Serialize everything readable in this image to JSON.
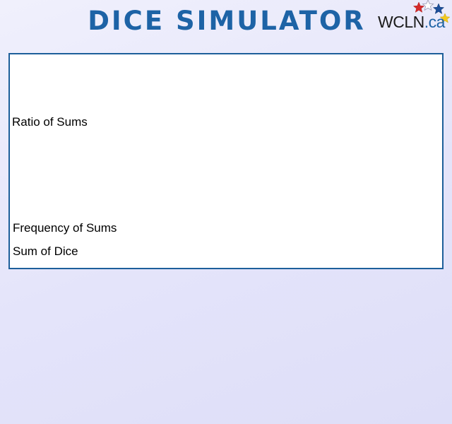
{
  "header": {
    "title": "DICE SIMULATOR",
    "logo": {
      "name": "WCLN",
      "domain": ".ca",
      "star_colors": [
        "#d42a2a",
        "#ffffff",
        "#1d4f9a",
        "#f2c81e"
      ]
    }
  },
  "panel": {
    "ratio_label": "Ratio of Sums",
    "frequency_label": "Frequency of Sums",
    "sum_label": "Sum of Dice"
  },
  "colors": {
    "title": "#1d63a6",
    "panel_border": "#1d5f9a",
    "background": "#e6e6fa"
  }
}
